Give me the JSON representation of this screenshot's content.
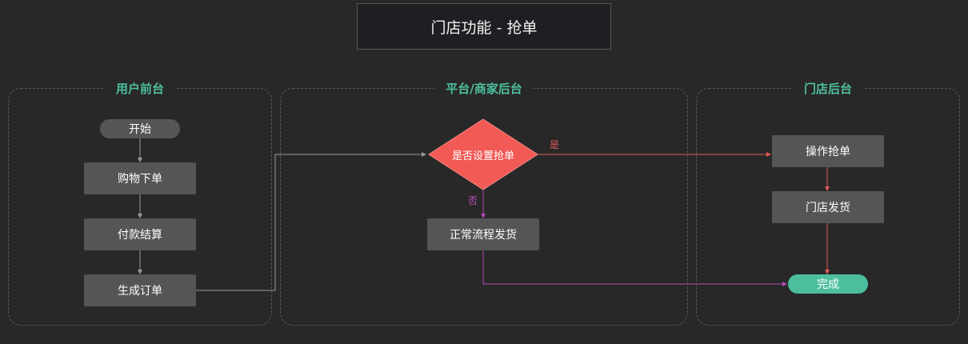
{
  "title": "门店功能 - 抢单",
  "lanes": {
    "user": {
      "title": "用户前台"
    },
    "platform": {
      "title": "平台/商家后台"
    },
    "store": {
      "title": "门店后台"
    }
  },
  "nodes": {
    "start": "开始",
    "shop_order": "购物下单",
    "pay": "付款结算",
    "create_order": "生成订单",
    "decision": "是否设置抢单",
    "normal_ship": "正常流程发货",
    "grab_order": "操作抢单",
    "store_ship": "门店发货",
    "done": "完成"
  },
  "edge_labels": {
    "yes": "是",
    "no": "否"
  },
  "colors": {
    "background": "#282828",
    "node": "#555555",
    "decision": "#f25a55",
    "done": "#4dbf9f",
    "lane_title": "#4dbf9f",
    "yes_edge": "#e35a55",
    "no_edge": "#b54ab3",
    "gray_edge": "#9a9a9a"
  }
}
